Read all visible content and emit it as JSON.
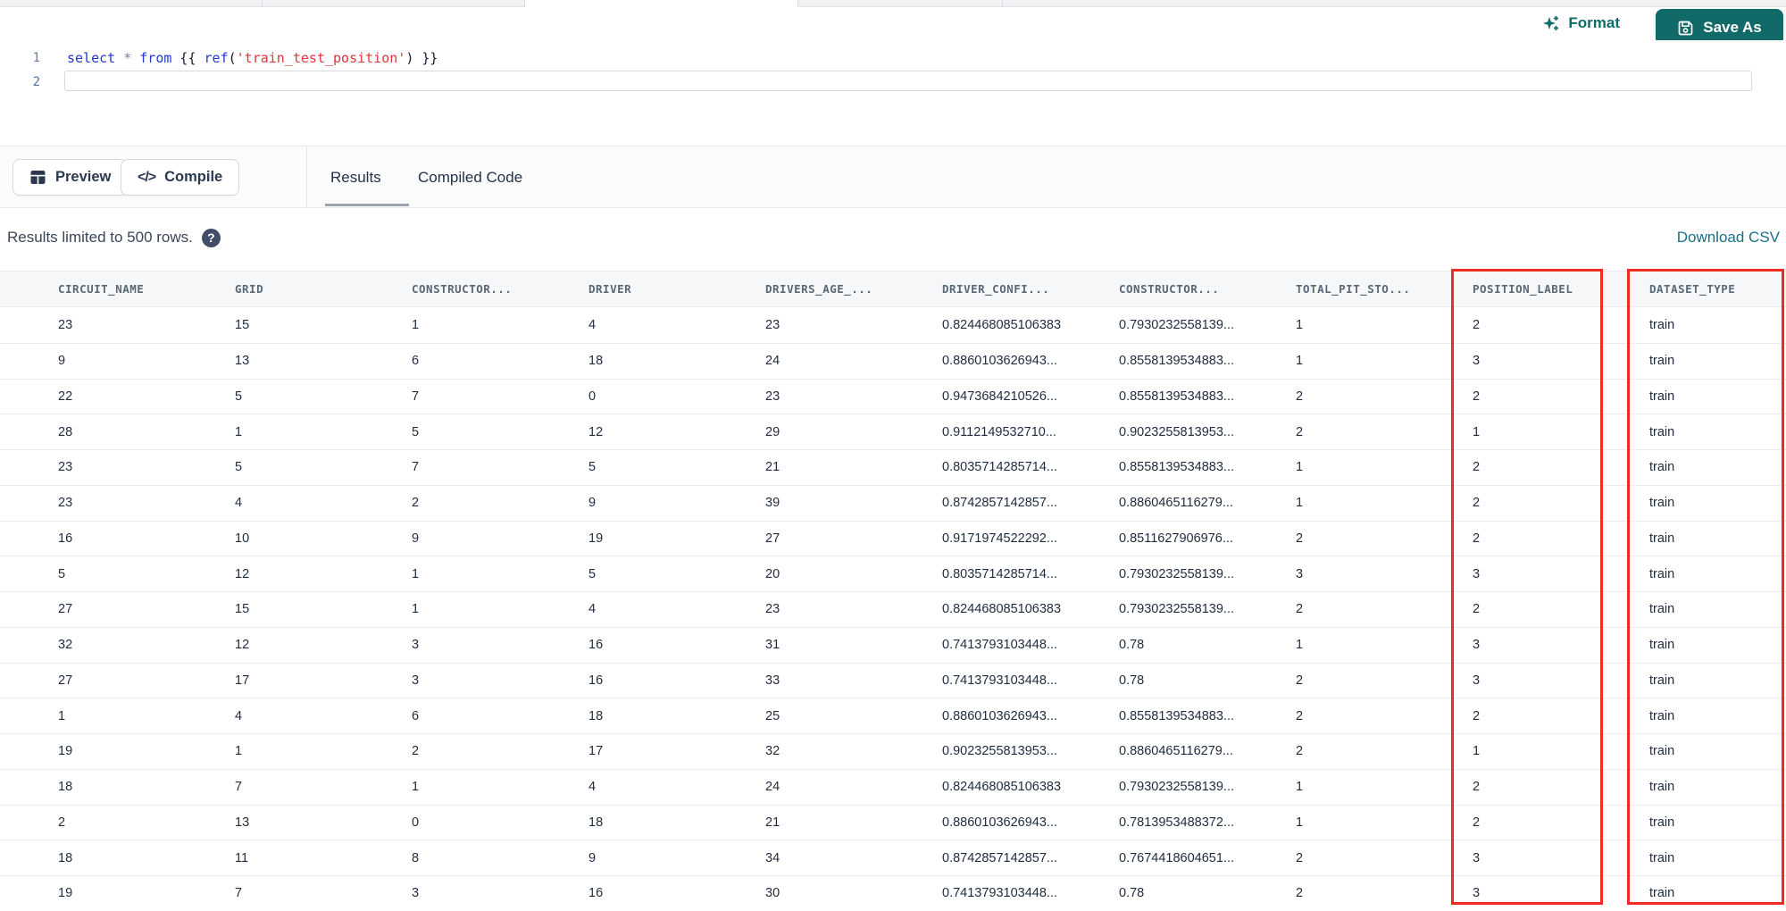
{
  "colors": {
    "accent_teal": "#116a68",
    "format_teal": "#0f6c66",
    "download_link_teal": "#177084",
    "highlight_red": "#ef2b24"
  },
  "top_toolbar": {
    "format_label": "Format",
    "save_as_label": "Save As"
  },
  "editor": {
    "line_numbers": [
      "1",
      "2"
    ],
    "code_line_1_text": "select * from {{ ref('train_test_position') }}",
    "code_tokens": [
      {
        "text": "select",
        "type": "keyword"
      },
      {
        "text": " ",
        "type": "plain"
      },
      {
        "text": "*",
        "type": "operator"
      },
      {
        "text": " ",
        "type": "plain"
      },
      {
        "text": "from",
        "type": "keyword"
      },
      {
        "text": " {{ ",
        "type": "plain"
      },
      {
        "text": "ref",
        "type": "function"
      },
      {
        "text": "(",
        "type": "plain"
      },
      {
        "text": "'train_test_position'",
        "type": "string"
      },
      {
        "text": ")",
        "type": "plain"
      },
      {
        "text": " }}",
        "type": "plain"
      }
    ]
  },
  "actions": {
    "preview_label": "Preview",
    "compile_label": "Compile",
    "compile_icon_glyph": "</>"
  },
  "tabs": [
    {
      "label": "Results",
      "active": true
    },
    {
      "label": "Compiled Code",
      "active": false
    }
  ],
  "results_bar": {
    "limit_text": "Results limited to 500 rows.",
    "help_glyph": "?",
    "download_csv_label": "Download CSV"
  },
  "table": {
    "columns": [
      "CIRCUIT_NAME",
      "GRID",
      "CONSTRUCTOR...",
      "DRIVER",
      "DRIVERS_AGE_...",
      "DRIVER_CONFI...",
      "CONSTRUCTOR...",
      "TOTAL_PIT_STO...",
      "POSITION_LABEL",
      "DATASET_TYPE"
    ],
    "highlighted_columns": [
      "POSITION_LABEL",
      "DATASET_TYPE"
    ],
    "rows": [
      [
        "23",
        "15",
        "1",
        "4",
        "23",
        "0.824468085106383",
        "0.7930232558139...",
        "1",
        "2",
        "train"
      ],
      [
        "9",
        "13",
        "6",
        "18",
        "24",
        "0.8860103626943...",
        "0.8558139534883...",
        "1",
        "3",
        "train"
      ],
      [
        "22",
        "5",
        "7",
        "0",
        "23",
        "0.9473684210526...",
        "0.8558139534883...",
        "2",
        "2",
        "train"
      ],
      [
        "28",
        "1",
        "5",
        "12",
        "29",
        "0.9112149532710...",
        "0.9023255813953...",
        "2",
        "1",
        "train"
      ],
      [
        "23",
        "5",
        "7",
        "5",
        "21",
        "0.8035714285714...",
        "0.8558139534883...",
        "1",
        "2",
        "train"
      ],
      [
        "23",
        "4",
        "2",
        "9",
        "39",
        "0.8742857142857...",
        "0.8860465116279...",
        "1",
        "2",
        "train"
      ],
      [
        "16",
        "10",
        "9",
        "19",
        "27",
        "0.9171974522292...",
        "0.8511627906976...",
        "2",
        "2",
        "train"
      ],
      [
        "5",
        "12",
        "1",
        "5",
        "20",
        "0.8035714285714...",
        "0.7930232558139...",
        "3",
        "3",
        "train"
      ],
      [
        "27",
        "15",
        "1",
        "4",
        "23",
        "0.824468085106383",
        "0.7930232558139...",
        "2",
        "2",
        "train"
      ],
      [
        "32",
        "12",
        "3",
        "16",
        "31",
        "0.7413793103448...",
        "0.78",
        "1",
        "3",
        "train"
      ],
      [
        "27",
        "17",
        "3",
        "16",
        "33",
        "0.7413793103448...",
        "0.78",
        "2",
        "3",
        "train"
      ],
      [
        "1",
        "4",
        "6",
        "18",
        "25",
        "0.8860103626943...",
        "0.8558139534883...",
        "2",
        "2",
        "train"
      ],
      [
        "19",
        "1",
        "2",
        "17",
        "32",
        "0.9023255813953...",
        "0.8860465116279...",
        "2",
        "1",
        "train"
      ],
      [
        "18",
        "7",
        "1",
        "4",
        "24",
        "0.824468085106383",
        "0.7930232558139...",
        "1",
        "2",
        "train"
      ],
      [
        "2",
        "13",
        "0",
        "18",
        "21",
        "0.8860103626943...",
        "0.7813953488372...",
        "1",
        "2",
        "train"
      ],
      [
        "18",
        "11",
        "8",
        "9",
        "34",
        "0.8742857142857...",
        "0.7674418604651...",
        "2",
        "3",
        "train"
      ],
      [
        "19",
        "7",
        "3",
        "16",
        "30",
        "0.7413793103448...",
        "0.78",
        "2",
        "3",
        "train"
      ]
    ]
  }
}
